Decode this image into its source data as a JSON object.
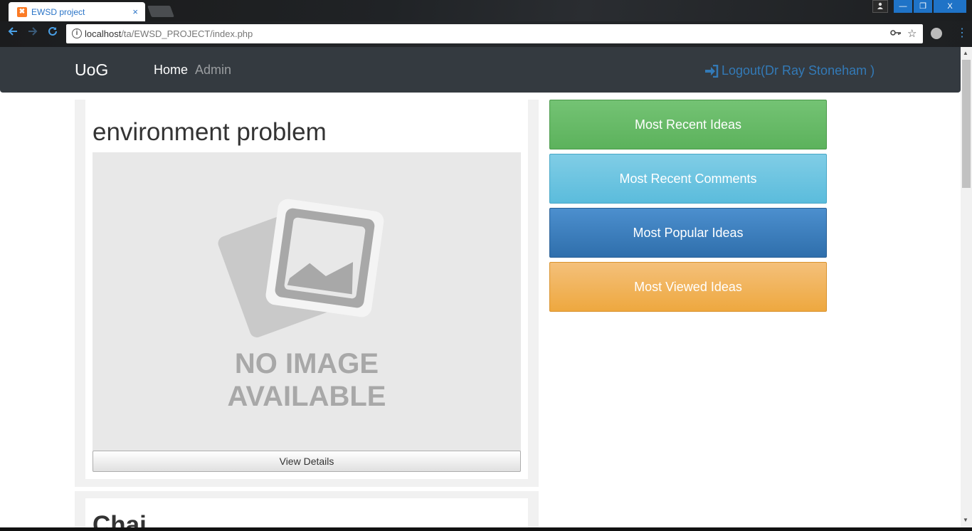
{
  "browser": {
    "tab_title": "EWSD project",
    "tab_close": "×",
    "url_host": "localhost",
    "url_path": "/ta/EWSD_PROJECT/index.php",
    "back_icon": "arrow-left-icon",
    "forward_icon": "arrow-right-icon",
    "reload_icon": "reload-icon",
    "win_minimize": "—",
    "win_restore": "❐",
    "win_close": "X"
  },
  "navbar": {
    "brand": "UoG",
    "home": "Home",
    "admin": "Admin",
    "logout": "Logout(Dr Ray Stoneham )",
    "bg_color": "#343a40",
    "link_color": "#337ab7"
  },
  "ideas": [
    {
      "title": "environment problem",
      "image_text_line1": "NO IMAGE",
      "image_text_line2": "AVAILABLE",
      "view_details": "View Details"
    },
    {
      "title": "Chai"
    }
  ],
  "sidebar": {
    "most_recent_ideas": "Most Recent Ideas",
    "most_recent_comments": "Most Recent Comments",
    "most_popular_ideas": "Most Popular Ideas",
    "most_viewed_ideas": "Most Viewed Ideas",
    "colors": {
      "green": "#5cb85c",
      "cyan": "#5bc0de",
      "blue": "#337ab7",
      "orange": "#f0ad4e"
    }
  }
}
